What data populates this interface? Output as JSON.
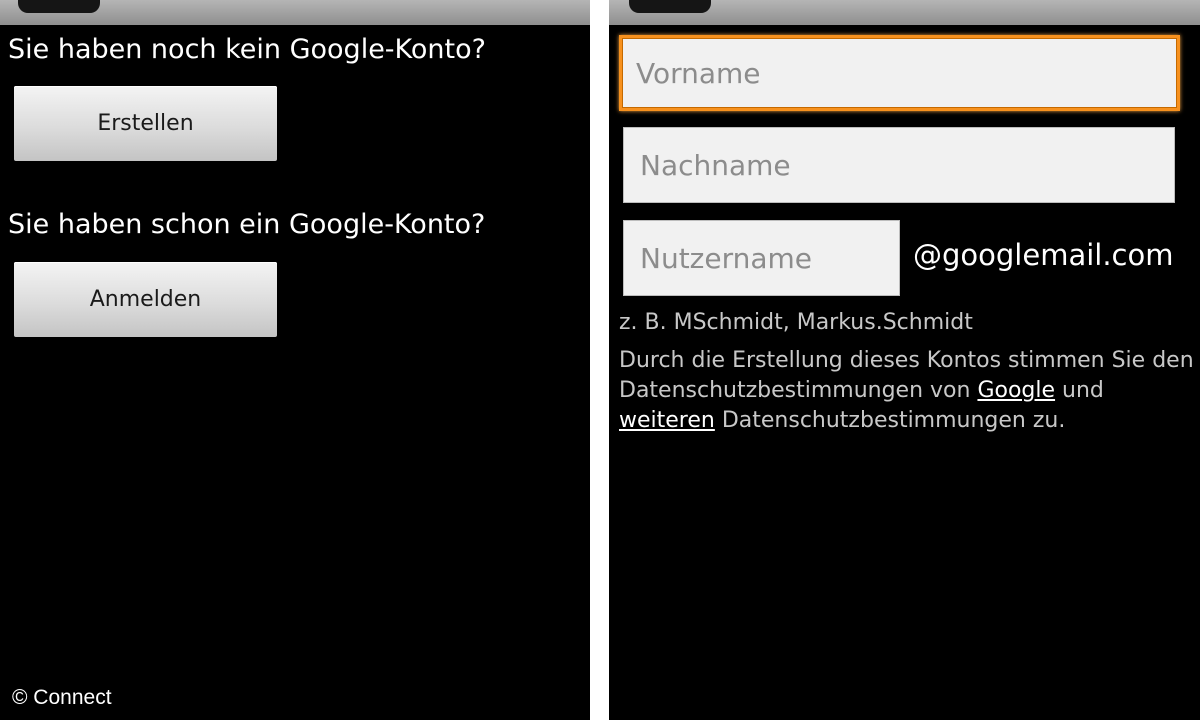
{
  "left_screen": {
    "no_account_heading": "Sie haben noch kein Google-Konto?",
    "create_button": "Erstellen",
    "has_account_heading": "Sie haben schon ein Google-Konto?",
    "login_button": "Anmelden",
    "copyright": "© Connect"
  },
  "right_screen": {
    "first_name_placeholder": "Vorname",
    "last_name_placeholder": "Nachname",
    "username_placeholder": "Nutzername",
    "domain_suffix": "@googlemail.com",
    "example_hint": "z. B. MSchmidt, Markus.Schmidt",
    "terms": {
      "part1": "Durch die Erstellung dieses Kontos stimmen Sie den Datenschutzbestimmungen von ",
      "google_link": "Google",
      "part2": " und ",
      "further_link": "weiteren",
      "part3": " Datenschutzbestimmungen zu."
    }
  },
  "colors": {
    "background": "#000000",
    "focus_border": "#f7911e",
    "link": "#ffffff"
  }
}
